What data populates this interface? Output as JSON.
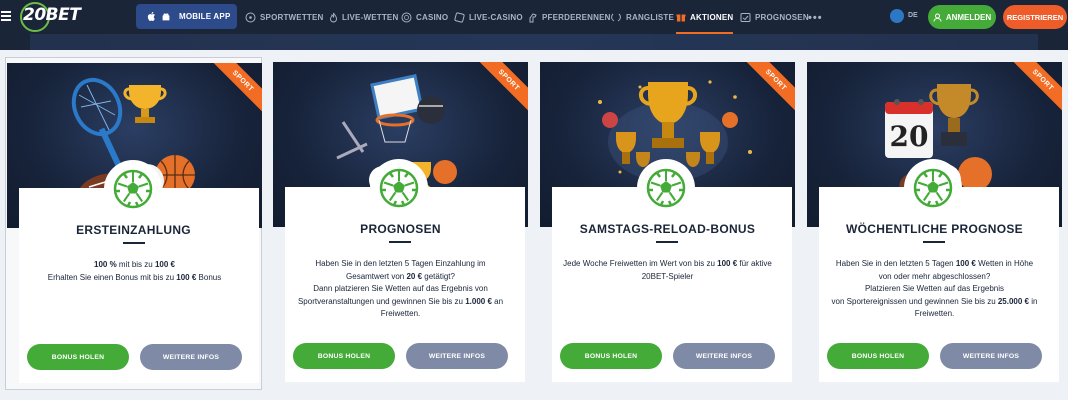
{
  "header": {
    "logo": "20BET",
    "mobile_app": "MOBILE APP",
    "nav": [
      {
        "label": "SPORTWETTEN",
        "icon": "soccer-ball-icon"
      },
      {
        "label": "LIVE-WETTEN",
        "icon": "flame-icon"
      },
      {
        "label": "CASINO",
        "icon": "chip-icon"
      },
      {
        "label": "LIVE-CASINO",
        "icon": "dice-icon"
      },
      {
        "label": "PFERDERENNEN",
        "icon": "horse-icon"
      },
      {
        "label": "RANGLISTE",
        "icon": "laurel-icon"
      },
      {
        "label": "AKTIONEN",
        "icon": "gift-icon"
      },
      {
        "label": "PROGNOSEN",
        "icon": "forecast-icon"
      }
    ],
    "active_nav": "AKTIONEN",
    "more": "•••",
    "language": "DE",
    "login": "ANMELDEN",
    "register": "REGISTRIEREN"
  },
  "colors": {
    "header_bg": "#1a2538",
    "accent_orange": "#f26d23",
    "green": "#44ab39",
    "grey_button": "#7f8ba6"
  },
  "cards": [
    {
      "badge": "SPORT",
      "title": "ERSTEINZAHLUNG",
      "desc": [
        [
          {
            "t": "100 %",
            "b": true
          },
          {
            "t": " mit bis zu ",
            "b": false
          },
          {
            "t": "100 €",
            "b": true
          }
        ],
        [
          {
            "t": "Erhalten Sie einen Bonus mit bis zu ",
            "b": false
          },
          {
            "t": "100 €",
            "b": true
          },
          {
            "t": " Bonus",
            "b": false
          }
        ]
      ],
      "btn_primary": "BONUS HOLEN",
      "btn_secondary": "WEITERE INFOS"
    },
    {
      "badge": "SPORT",
      "title": "PROGNOSEN",
      "desc": [
        [
          {
            "t": "Haben Sie in den letzten 5 Tagen Einzahlung im",
            "b": false
          }
        ],
        [
          {
            "t": "Gesamtwert von ",
            "b": false
          },
          {
            "t": "20 €",
            "b": true
          },
          {
            "t": " getätigt?",
            "b": false
          }
        ],
        [
          {
            "t": "Dann platzieren Sie Wetten auf das Ergebnis von",
            "b": false
          }
        ],
        [
          {
            "t": "Sportveranstaltungen und gewinnen Sie bis zu ",
            "b": false
          },
          {
            "t": "1.000 €",
            "b": true
          },
          {
            "t": " an",
            "b": false
          }
        ],
        [
          {
            "t": "Freiwetten.",
            "b": false
          }
        ]
      ],
      "btn_primary": "BONUS HOLEN",
      "btn_secondary": "WEITERE INFOS"
    },
    {
      "badge": "SPORT",
      "title": "SAMSTAGS-RELOAD-BONUS",
      "desc": [
        [
          {
            "t": "Jede Woche Freiwetten im Wert von bis zu ",
            "b": false
          },
          {
            "t": "100 €",
            "b": true
          },
          {
            "t": " für aktive",
            "b": false
          }
        ],
        [
          {
            "t": "20BET-Spieler",
            "b": false
          }
        ]
      ],
      "btn_primary": "BONUS HOLEN",
      "btn_secondary": "WEITERE INFOS"
    },
    {
      "badge": "SPORT",
      "title": "WÖCHENTLICHE PROGNOSE",
      "desc": [
        [
          {
            "t": "Haben Sie in den letzten 5 Tagen ",
            "b": false
          },
          {
            "t": "100 €",
            "b": true
          },
          {
            "t": " Wetten in Höhe",
            "b": false
          }
        ],
        [
          {
            "t": "von oder mehr abgeschlossen?",
            "b": false
          }
        ],
        [
          {
            "t": "Platzieren Sie Wetten auf das Ergebnis",
            "b": false
          }
        ],
        [
          {
            "t": "von Sportereignissen und gewinnen Sie bis zu ",
            "b": false
          },
          {
            "t": "25.000 €",
            "b": true
          },
          {
            "t": " in",
            "b": false
          }
        ],
        [
          {
            "t": "Freiwetten.",
            "b": false
          }
        ]
      ],
      "btn_primary": "BONUS HOLEN",
      "btn_secondary": "WEITERE INFOS"
    }
  ],
  "calendar_number": "20"
}
